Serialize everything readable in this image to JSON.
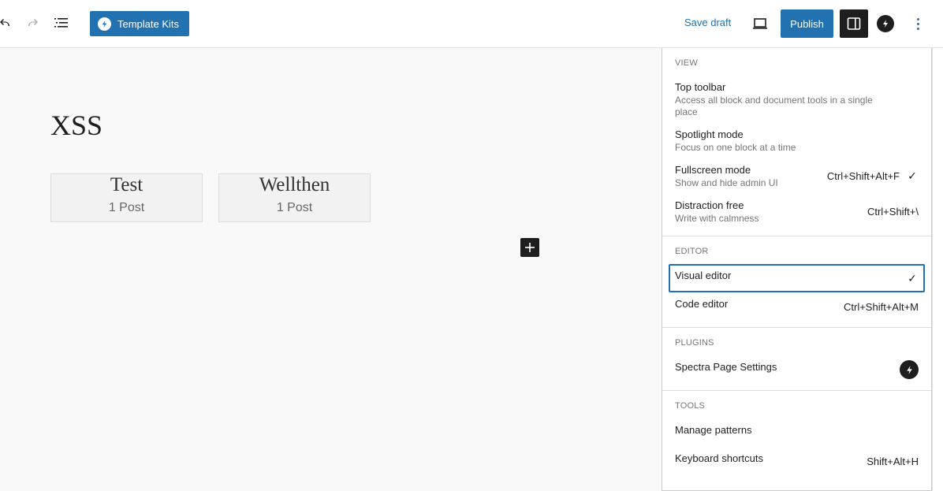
{
  "toolbar": {
    "template_kits_label": "Template Kits",
    "save_draft_label": "Save draft",
    "publish_label": "Publish"
  },
  "canvas": {
    "post_title": "XSS",
    "cards": [
      {
        "name": "Test",
        "count": "1 Post"
      },
      {
        "name": "Wellthen",
        "count": "1 Post"
      }
    ]
  },
  "menu": {
    "view": {
      "title": "VIEW",
      "items": [
        {
          "label": "Top toolbar",
          "desc": "Access all block and document tools in a single place",
          "shortcut": "",
          "checked": false
        },
        {
          "label": "Spotlight mode",
          "desc": "Focus on one block at a time",
          "shortcut": "",
          "checked": false
        },
        {
          "label": "Fullscreen mode",
          "desc": "Show and hide admin UI",
          "shortcut": "Ctrl+Shift+Alt+F",
          "checked": true
        },
        {
          "label": "Distraction free",
          "desc": "Write with calmness",
          "shortcut": "Ctrl+Shift+\\",
          "checked": false
        }
      ]
    },
    "editor": {
      "title": "EDITOR",
      "items": [
        {
          "label": "Visual editor",
          "shortcut": "",
          "checked": true
        },
        {
          "label": "Code editor",
          "shortcut": "Ctrl+Shift+Alt+M",
          "checked": false
        }
      ]
    },
    "plugins": {
      "title": "PLUGINS",
      "items": [
        {
          "label": "Spectra Page Settings",
          "icon": "spectra-icon"
        }
      ]
    },
    "tools": {
      "title": "TOOLS",
      "items": [
        {
          "label": "Manage patterns",
          "shortcut": ""
        },
        {
          "label": "Keyboard shortcuts",
          "shortcut": "Shift+Alt+H"
        }
      ]
    }
  },
  "colors": {
    "accent": "#2271b1",
    "dark": "#1e1e1e"
  }
}
